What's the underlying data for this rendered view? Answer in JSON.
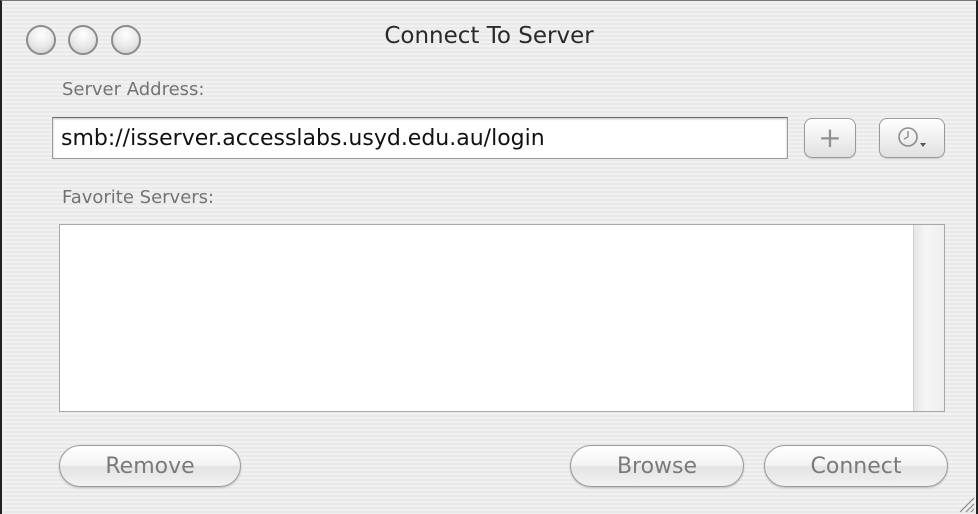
{
  "window": {
    "title": "Connect To Server"
  },
  "server_address": {
    "label": "Server Address:",
    "value": "smb://isserver.accesslabs.usyd.edu.au/login",
    "add_button_glyph": "+",
    "add_button_icon": "plus-icon",
    "recent_button_icon": "clock-icon"
  },
  "favorites": {
    "label": "Favorite Servers:",
    "items": []
  },
  "buttons": {
    "remove": "Remove",
    "browse": "Browse",
    "connect": "Connect"
  }
}
